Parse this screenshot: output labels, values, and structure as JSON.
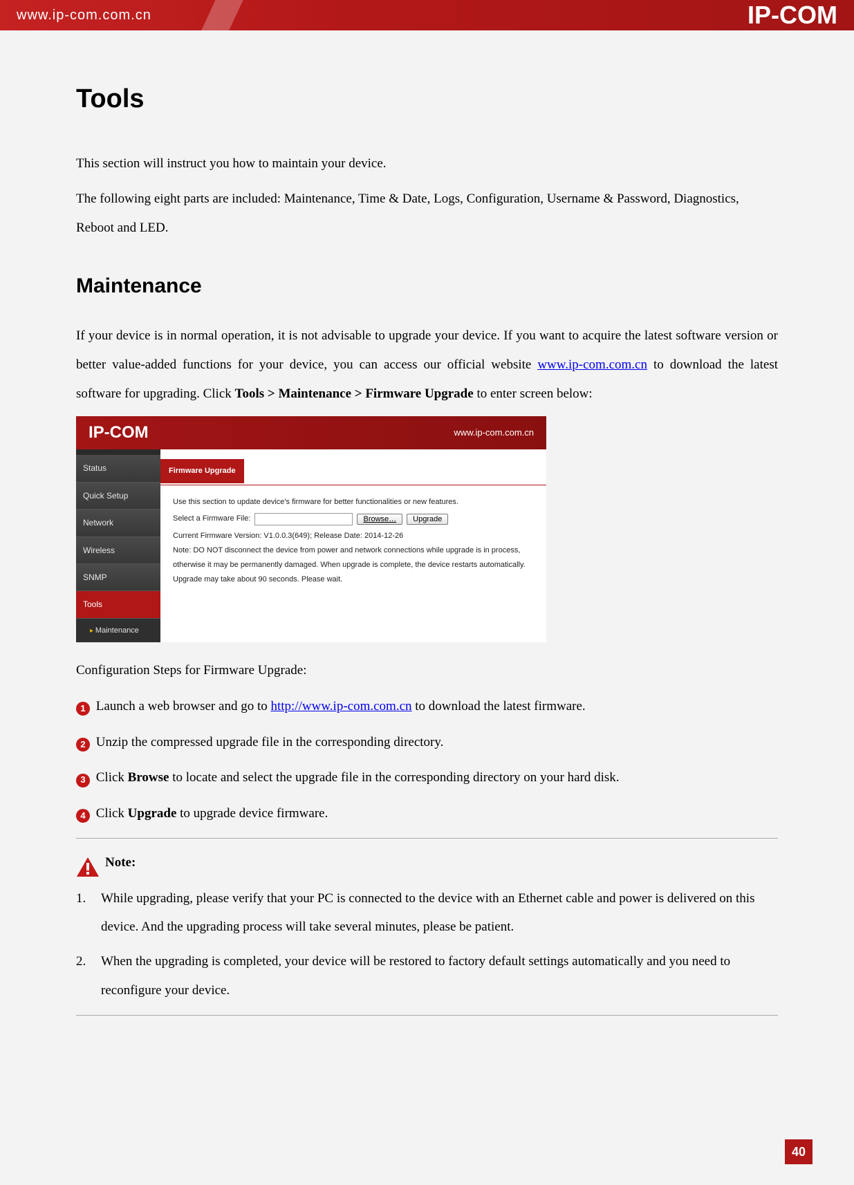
{
  "header": {
    "url": "www.ip-com.com.cn",
    "logo_text": "IP-COM"
  },
  "h1": "Tools",
  "intro1": "This section will instruct you how to maintain your device.",
  "intro2": "The following eight parts are included: Maintenance, Time & Date, Logs, Configuration, Username & Password, Diagnostics, Reboot and LED.",
  "h2": "Maintenance",
  "maint_p1_a": "If your device is in normal operation, it is not advisable to upgrade your device. If you want to acquire the latest software version or better value-added functions for your device, you can access our official website ",
  "maint_link": "www.ip-com.com.cn",
  "maint_p1_b": " to download the latest software for upgrading. Click ",
  "maint_path": "Tools > Maintenance > Firmware Upgrade",
  "maint_p1_c": " to enter screen below:",
  "screenshot": {
    "logo": "IP-COM",
    "url": "www.ip-com.com.cn",
    "tab": "Firmware Upgrade",
    "nav": [
      "Status",
      "Quick Setup",
      "Network",
      "Wireless",
      "SNMP",
      "Tools"
    ],
    "nav_sub": "Maintenance",
    "line1": "Use this section to update device's firmware for better functionalities or new features.",
    "select_label": "Select a Firmware File:",
    "browse": "Browse…",
    "upgrade": "Upgrade",
    "version": "Current Firmware Version: V1.0.0.3(649); Release Date: 2014-12-26",
    "note": "Note: DO NOT disconnect the device from power and network connections while upgrade is in process, otherwise it may be permanently damaged. When upgrade is complete, the device restarts automatically. Upgrade may take about 90 seconds. Please wait."
  },
  "steps_title": "Configuration Steps for Firmware Upgrade:",
  "step1_a": " Launch a web browser and go to ",
  "step1_link": "http://www.ip-com.com.cn",
  "step1_b": " to download the latest firmware.",
  "step2": " Unzip the compressed upgrade file in the corresponding directory.",
  "step3_a": " Click ",
  "step3_b": "Browse",
  "step3_c": " to locate and select the upgrade file in the corresponding directory on your hard disk.",
  "step4_a": " Click ",
  "step4_b": "Upgrade",
  "step4_c": " to upgrade device firmware.",
  "note_label": "Note:",
  "note1_n": "1.",
  "note1": "While upgrading, please verify that your PC is connected to the device with an Ethernet cable and power is delivered on this device. And the upgrading process will take several minutes, please be patient.",
  "note2_n": "2.",
  "note2": "When the upgrading is completed, your device will be restored to factory default settings automatically and you need to reconfigure your device.",
  "pagenum": "40",
  "nums": {
    "n1": "1",
    "n2": "2",
    "n3": "3",
    "n4": "4"
  }
}
